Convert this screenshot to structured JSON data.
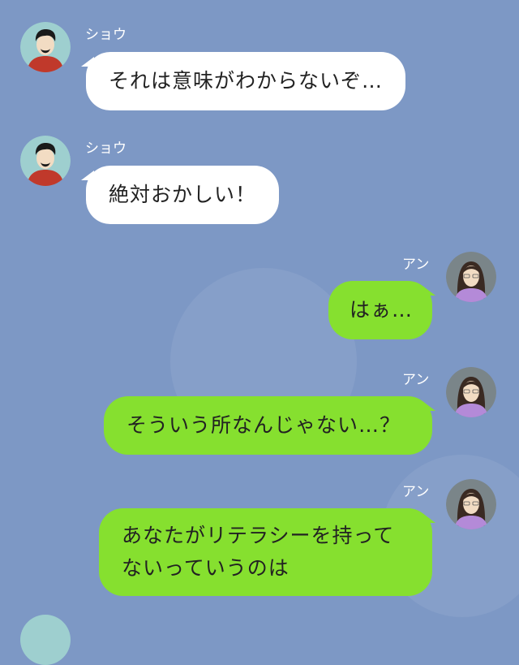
{
  "colors": {
    "background": "#7d98c5",
    "incoming_bubble": "#ffffff",
    "outgoing_bubble": "#86e02f",
    "name_text": "#ffffff"
  },
  "messages": [
    {
      "side": "left",
      "sender": "ショウ",
      "avatar": "male-avatar-icon",
      "lines": [
        "それは意味がわからないぞ…"
      ]
    },
    {
      "side": "left",
      "sender": "ショウ",
      "avatar": "male-avatar-icon",
      "lines": [
        "絶対おかしい！"
      ]
    },
    {
      "side": "right",
      "sender": "アン",
      "avatar": "female-avatar-icon",
      "lines": [
        "はぁ…"
      ]
    },
    {
      "side": "right",
      "sender": "アン",
      "avatar": "female-avatar-icon",
      "lines": [
        "そういう所なんじゃない…？"
      ]
    },
    {
      "side": "right",
      "sender": "アン",
      "avatar": "female-avatar-icon",
      "lines": [
        "あなたがリテラシーを持って",
        "ないっていうのは"
      ]
    }
  ]
}
